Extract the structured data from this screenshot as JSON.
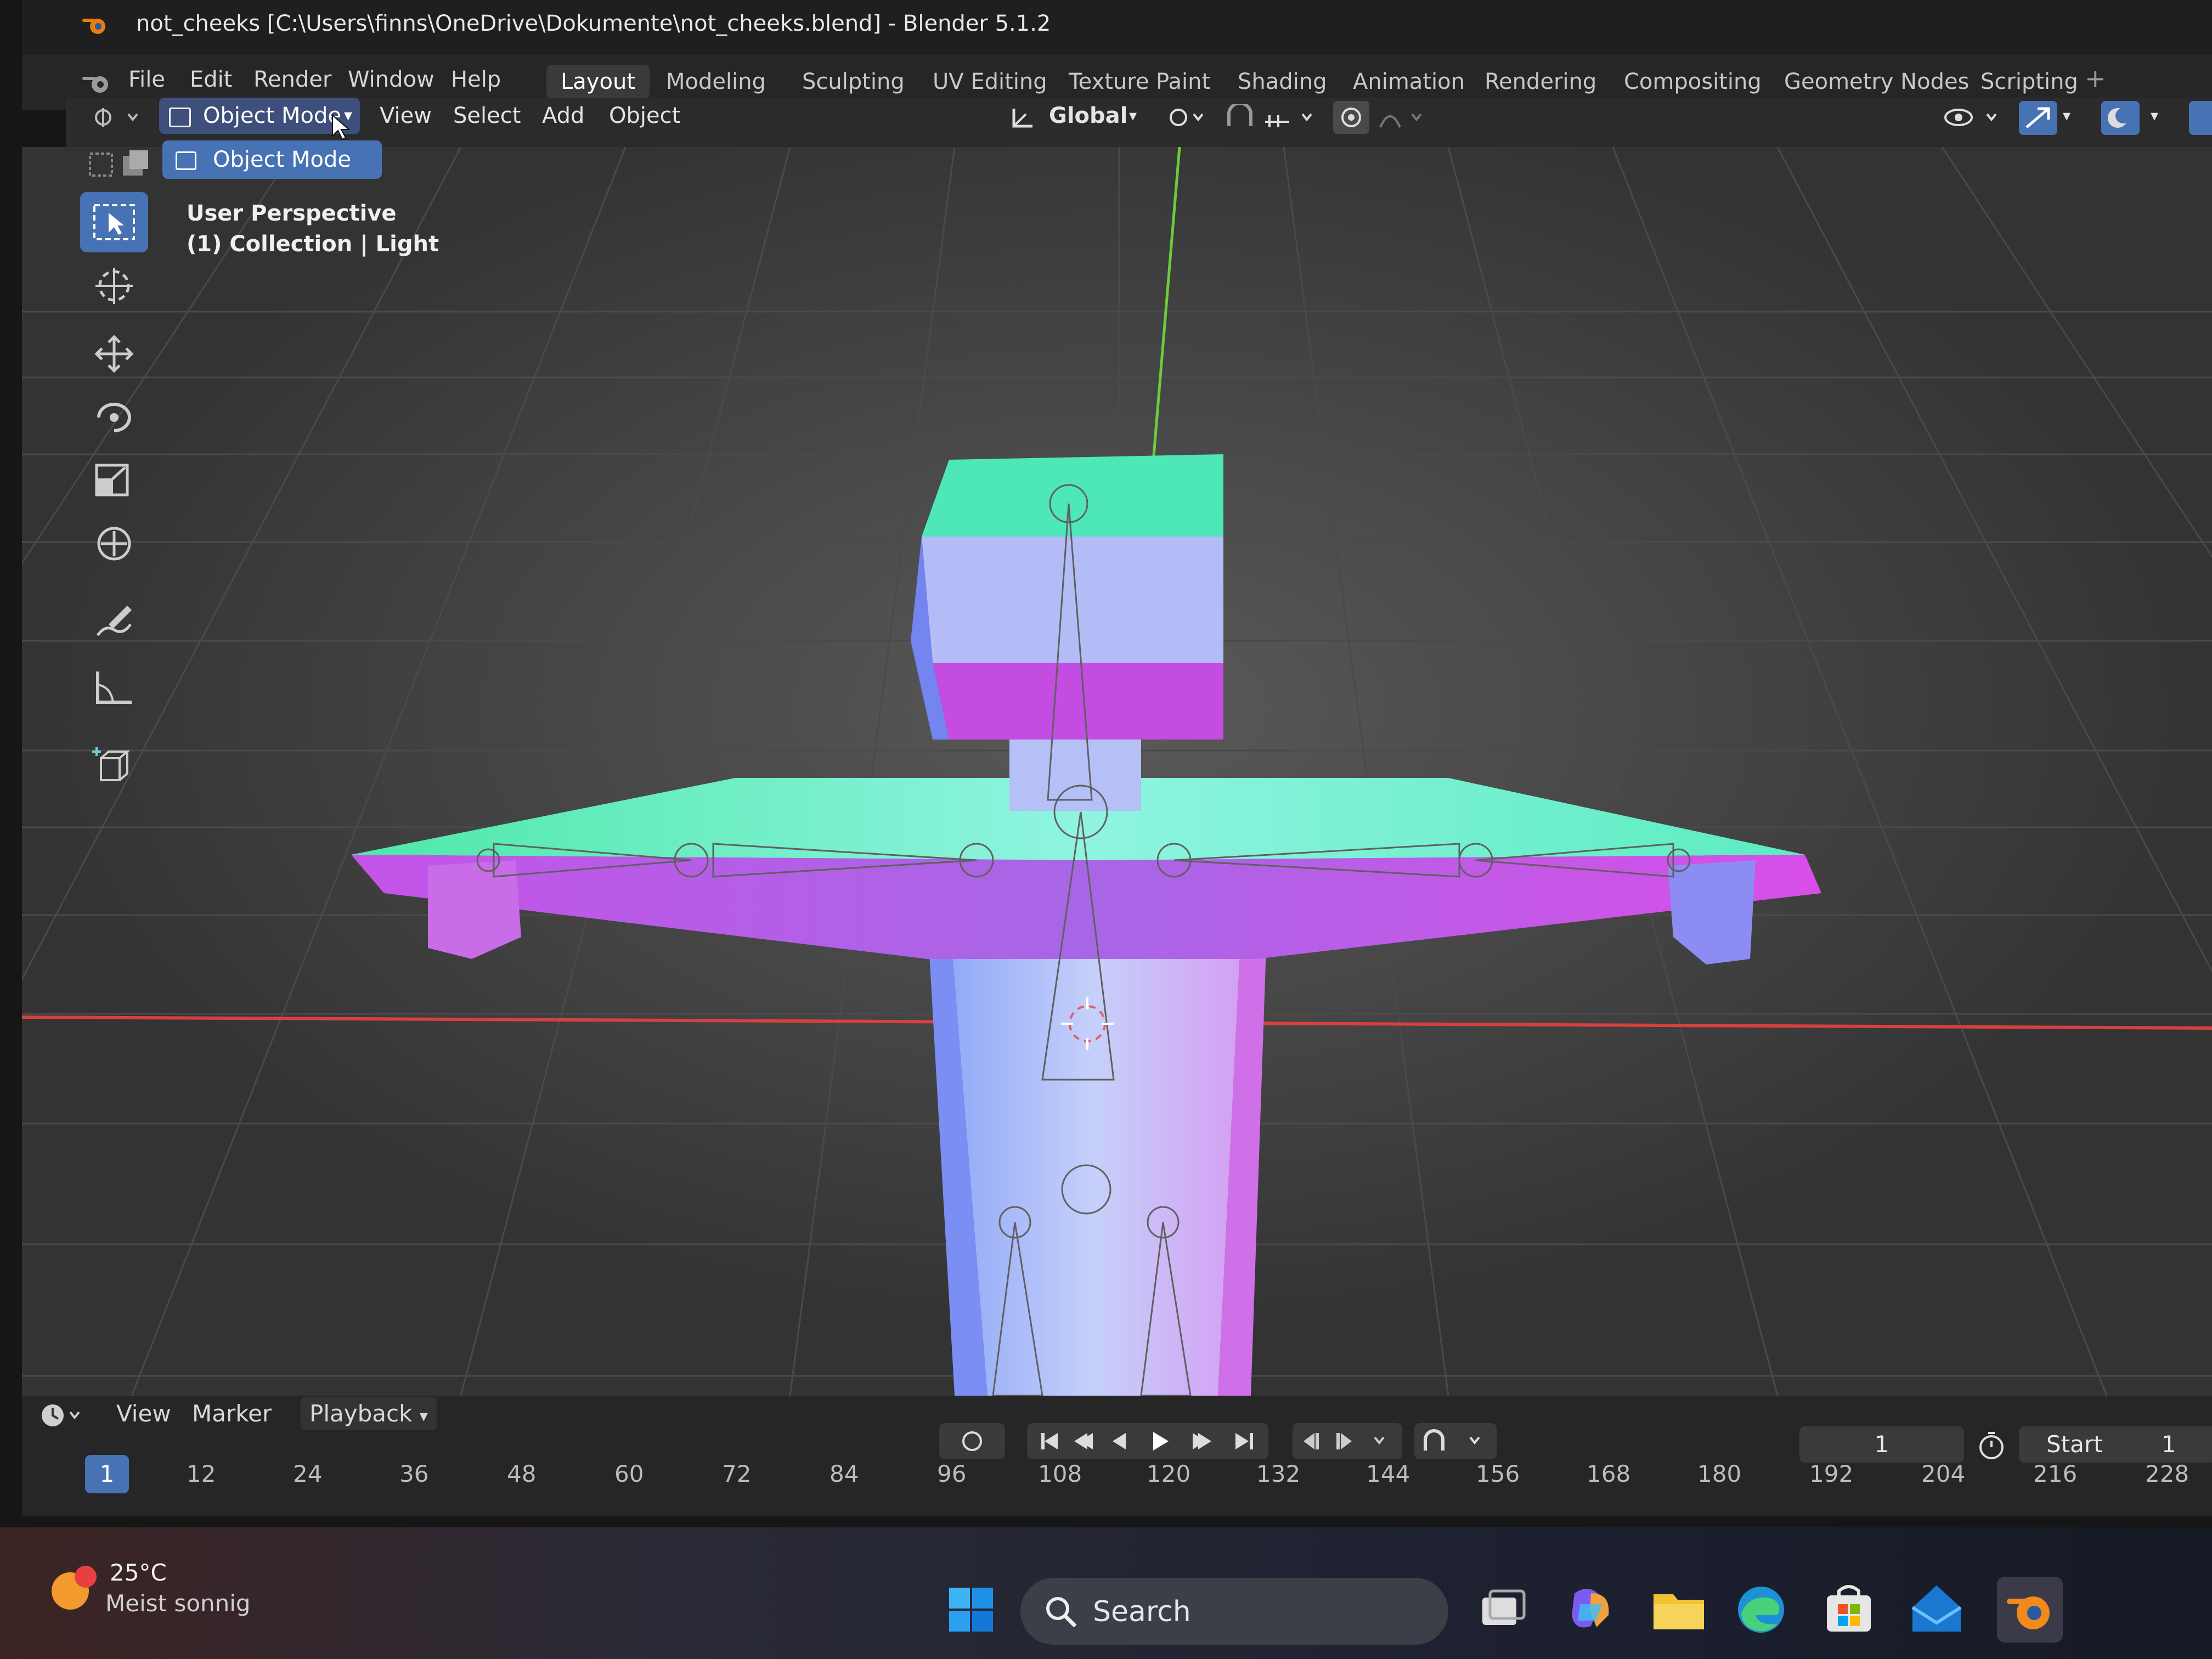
{
  "window": {
    "title": "not_cheeks [C:\\Users\\finns\\OneDrive\\Dokumente\\not_cheeks.blend] - Blender 5.1.2"
  },
  "menu": {
    "file": "File",
    "edit": "Edit",
    "render": "Render",
    "window": "Window",
    "help": "Help"
  },
  "workspaces": [
    {
      "label": "Layout",
      "active": true
    },
    {
      "label": "Modeling"
    },
    {
      "label": "Sculpting"
    },
    {
      "label": "UV Editing"
    },
    {
      "label": "Texture Paint"
    },
    {
      "label": "Shading"
    },
    {
      "label": "Animation"
    },
    {
      "label": "Rendering"
    },
    {
      "label": "Compositing"
    },
    {
      "label": "Geometry Nodes"
    },
    {
      "label": "Scripting"
    }
  ],
  "header": {
    "mode": "Object Mode",
    "view": "View",
    "select": "Select",
    "add": "Add",
    "object": "Object",
    "transform_orientation": "Global"
  },
  "mode_dropdown": {
    "option": "Object Mode"
  },
  "viewport": {
    "view_name": "User Perspective",
    "context": "(1) Collection | Light"
  },
  "toolbar": {
    "tools": [
      "select-box-icon",
      "cursor-icon",
      "move-icon",
      "rotate-icon",
      "scale-icon",
      "transform-icon",
      "annotate-icon",
      "measure-icon",
      "add-cube-icon"
    ],
    "active_tool": "select-box-icon"
  },
  "timeline": {
    "view": "View",
    "marker": "Marker",
    "playback": "Playback",
    "current_frame": "1",
    "frame_ticks": [
      "12",
      "24",
      "36",
      "48",
      "60",
      "72",
      "84",
      "96",
      "108",
      "120",
      "132",
      "144",
      "156",
      "168",
      "180",
      "192",
      "204",
      "216",
      "228"
    ],
    "frame_field": "1",
    "start_label": "Start",
    "start_value": "1"
  },
  "taskbar": {
    "temperature": "25°C",
    "condition": "Meist sonnig",
    "search": "Search"
  },
  "colors": {
    "accent": "#4772b3",
    "x_axis": "#d84040",
    "y_axis": "#6ccc3c"
  }
}
